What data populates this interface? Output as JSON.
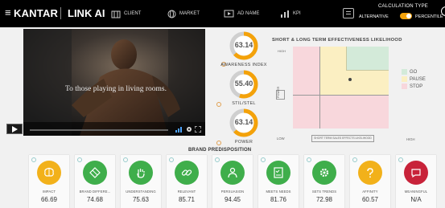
{
  "header": {
    "brand": "KANTAR",
    "product": "LINK AI",
    "nav": [
      {
        "label": "CLIENT",
        "icon": "building-icon"
      },
      {
        "label": "MARKET",
        "icon": "globe-icon"
      },
      {
        "label": "AD NAME",
        "icon": "video-icon"
      },
      {
        "label": "KPI",
        "icon": "chart-icon"
      }
    ],
    "calc_title": "CALCULATION TYPE",
    "calc_left": "ALTERNATIVE",
    "calc_right": "PERCENTILE"
  },
  "video": {
    "caption": "To those playing in living rooms."
  },
  "gauges": [
    {
      "value": "63.14",
      "label": "AWARENESS INDEX",
      "fraction": 0.6314
    },
    {
      "value": "55.40",
      "label": "STIL/STEL",
      "fraction": 0.554
    },
    {
      "value": "63.14",
      "label": "POWER",
      "fraction": 0.6314
    }
  ],
  "matrix": {
    "title": "SHORT & LONG TERM EFFECTIVENESS LIKELIHOOD",
    "y_high": "HIGH",
    "y_low": "LOW",
    "y_axis": "POWER",
    "x_axis": "SHORT TERM SALES EFFECTS LIKELIHOOD",
    "x_high": "HIGH",
    "legend": [
      {
        "label": "GO",
        "color": "#d3ead9"
      },
      {
        "label": "PAUSE",
        "color": "#fbefc2"
      },
      {
        "label": "STOP",
        "color": "#f8d7dc"
      }
    ],
    "point": {
      "x": 0.6,
      "y": 0.6
    }
  },
  "brand_predisposition": {
    "title": "BRAND PREDISPOSITION",
    "cards": [
      {
        "label": "IMPACT",
        "value": "66.69",
        "color": "#f2b11a",
        "icon": "brain-icon"
      },
      {
        "label": "BRAND DIFFERE...",
        "value": "74.68",
        "color": "#3fae4b",
        "icon": "diamond-icon"
      },
      {
        "label": "UNDERSTANDING",
        "value": "75.63",
        "color": "#3fae4b",
        "icon": "hand-icon"
      },
      {
        "label": "RELEVANT",
        "value": "85.71",
        "color": "#3fae4b",
        "icon": "link-icon"
      },
      {
        "label": "PERSUASION",
        "value": "94.45",
        "color": "#3fae4b",
        "icon": "people-icon"
      },
      {
        "label": "MEETS NEEDS",
        "value": "81.76",
        "color": "#3fae4b",
        "icon": "checklist-icon"
      },
      {
        "label": "SETS TRENDS",
        "value": "72.98",
        "color": "#3fae4b",
        "icon": "gear-icon"
      },
      {
        "label": "AFFINITY",
        "value": "60.57",
        "color": "#f2b11a",
        "icon": "question-icon"
      },
      {
        "label": "MEANINGFUL",
        "value": "N/A",
        "color": "#c8233a",
        "icon": "chat-icon"
      }
    ]
  }
}
